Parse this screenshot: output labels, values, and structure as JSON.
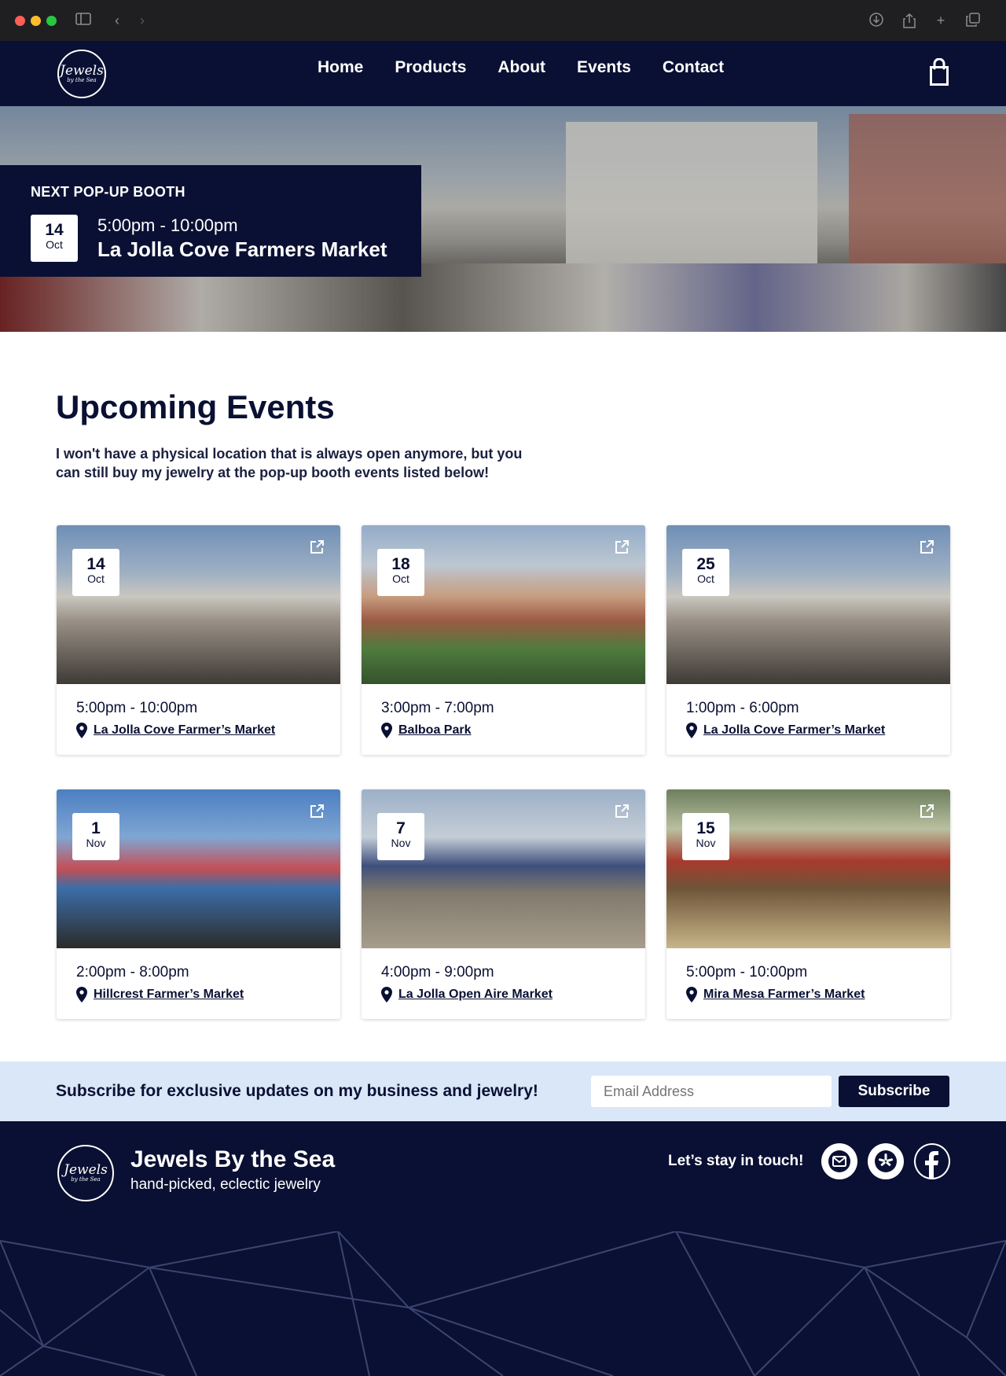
{
  "nav": {
    "logo_line1": "Jewels",
    "logo_line2": "by the Sea",
    "links": [
      "Home",
      "Products",
      "About",
      "Events",
      "Contact"
    ]
  },
  "hero": {
    "kicker": "NEXT POP-UP BOOTH",
    "day": "14",
    "month": "Oct",
    "time": "5:00pm - 10:00pm",
    "place": "La Jolla Cove Farmers Market"
  },
  "main": {
    "title": "Upcoming Events",
    "intro": "I won't have a physical location that is always open anymore, but you can still buy my jewelry at the pop-up booth events listed below!"
  },
  "events": [
    {
      "day": "14",
      "month": "Oct",
      "time": "5:00pm - 10:00pm",
      "location": "La Jolla Cove Farmer’s Market"
    },
    {
      "day": "18",
      "month": "Oct",
      "time": "3:00pm - 7:00pm",
      "location": "Balboa Park"
    },
    {
      "day": "25",
      "month": "Oct",
      "time": "1:00pm - 6:00pm",
      "location": "La Jolla Cove Farmer’s Market"
    },
    {
      "day": "1",
      "month": "Nov",
      "time": "2:00pm - 8:00pm",
      "location": "Hillcrest Farmer’s Market"
    },
    {
      "day": "7",
      "month": "Nov",
      "time": "4:00pm - 9:00pm",
      "location": "La Jolla Open Aire Market"
    },
    {
      "day": "15",
      "month": "Nov",
      "time": "5:00pm - 10:00pm",
      "location": "Mira Mesa Farmer’s Market"
    }
  ],
  "subscribe": {
    "text": "Subscribe for exclusive updates on my business and jewelry!",
    "placeholder": "Email Address",
    "button": "Subscribe"
  },
  "footer": {
    "brand": "Jewels By the Sea",
    "tagline": "hand-picked, eclectic jewelry",
    "stay": "Let’s stay in touch!",
    "social": [
      "mail-icon",
      "yelp-icon",
      "facebook-icon"
    ]
  },
  "colors": {
    "navy": "#0a1033",
    "subscribe_bg": "#d9e7f8"
  }
}
